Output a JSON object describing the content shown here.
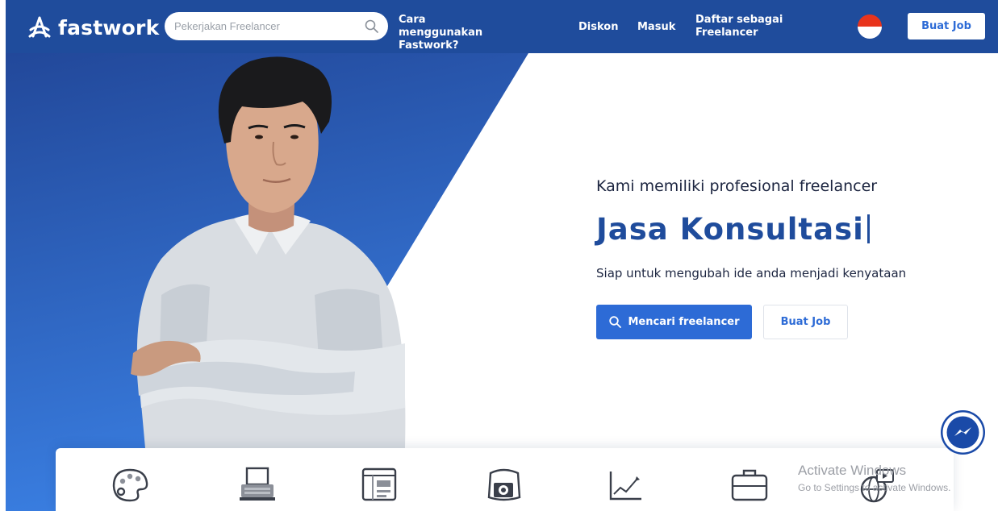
{
  "header": {
    "logo_text": "fastwork",
    "search_placeholder": "Pekerjakan Freelancer",
    "nav": {
      "how_to": "Cara menggunakan Fastwork?",
      "discount": "Diskon",
      "login": "Masuk",
      "register_freelancer": "Daftar sebagai Freelancer"
    },
    "cta_label": "Buat Job"
  },
  "hero": {
    "subtitle": "Kami memiliki profesional freelancer",
    "title": "Jasa Konsultasi",
    "tagline": "Siap untuk mengubah ide anda menjadi kenyataan",
    "primary_button": "Mencari freelancer",
    "secondary_button": "Buat Job"
  },
  "categories": [
    "palette-icon",
    "typewriter-icon",
    "web-layout-icon",
    "camera-icon",
    "line-chart-icon",
    "briefcase-icon",
    "globe-video-icon"
  ],
  "watermark": {
    "title": "Activate Windows",
    "subtitle": "Go to Settings to activate Windows."
  },
  "colors": {
    "nav_blue": "#1f4c9c",
    "accent_blue": "#2d6bd6",
    "hero_blue_top": "#24509f",
    "hero_blue_bottom": "#3b7ee0",
    "title_blue": "#1f4c9c"
  }
}
